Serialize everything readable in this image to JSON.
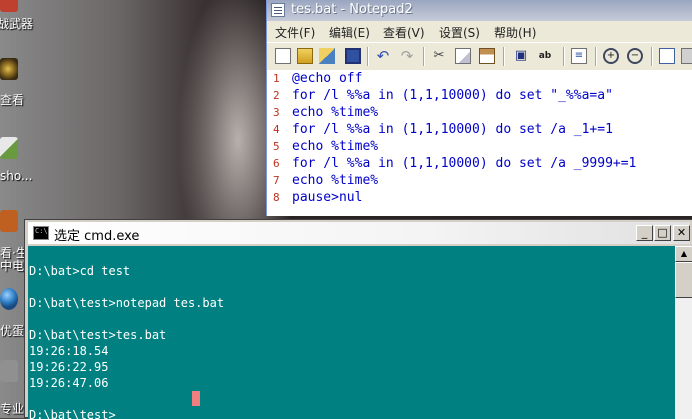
{
  "desktop": {
    "icons": [
      {
        "label": "战武器",
        "icon": "game-icon",
        "color": "#c04030"
      },
      {
        "label": "查看",
        "icon": "app-icon",
        "color": "#8a6a20"
      },
      {
        "label": "sho...",
        "icon": "shortcut-icon",
        "color": "#6a9a40"
      },
      {
        "label": "看·生\n中电影",
        "icon": "video-icon",
        "color": "#c06020"
      },
      {
        "label": "优蛋",
        "icon": "globe-icon",
        "color": "#2a7ac0"
      },
      {
        "label": "专业",
        "icon": "tool-icon",
        "color": "#909090"
      }
    ]
  },
  "notepad": {
    "title": "tes.bat - Notepad2",
    "menu": [
      "文件(F)",
      "编辑(E)",
      "查看(V)",
      "设置(S)",
      "帮助(H)"
    ],
    "toolbar": [
      "new-icon",
      "open-icon",
      "browse-icon",
      "save-icon",
      "undo-icon",
      "redo-icon",
      "cut-icon",
      "copy-icon",
      "paste-icon",
      "find-icon",
      "replace-icon",
      "wordwrap-icon",
      "zoom-in-icon",
      "zoom-out-icon",
      "view-icon",
      "settings-icon"
    ],
    "lines": [
      {
        "num": "1",
        "text": "@echo off"
      },
      {
        "num": "2",
        "text": "for /l %%a in (1,1,10000) do set \"_%%a=a\""
      },
      {
        "num": "3",
        "text": "echo %time%"
      },
      {
        "num": "4",
        "text": "for /l %%a in (1,1,10000) do set /a _1+=1"
      },
      {
        "num": "5",
        "text": "echo %time%"
      },
      {
        "num": "6",
        "text": "for /l %%a in (1,1,10000) do set /a _9999+=1"
      },
      {
        "num": "7",
        "text": "echo %time%"
      },
      {
        "num": "8",
        "text": "pause>nul"
      }
    ]
  },
  "cmd": {
    "title": "选定 cmd.exe",
    "buttons": {
      "minimize": "_",
      "maximize": "□",
      "close": "✕"
    },
    "lines": [
      "",
      "D:\\bat>cd test",
      "",
      "D:\\bat\\test>notepad tes.bat",
      "",
      "D:\\bat\\test>tes.bat",
      "19:26:18.54",
      "19:26:22.95",
      "19:26:47.06",
      "",
      "D:\\bat\\test>"
    ]
  },
  "colors": {
    "console_bg": "#008080",
    "console_fg": "#ffffff",
    "code_text": "#0000c8",
    "line_numbers": "#c03020"
  }
}
